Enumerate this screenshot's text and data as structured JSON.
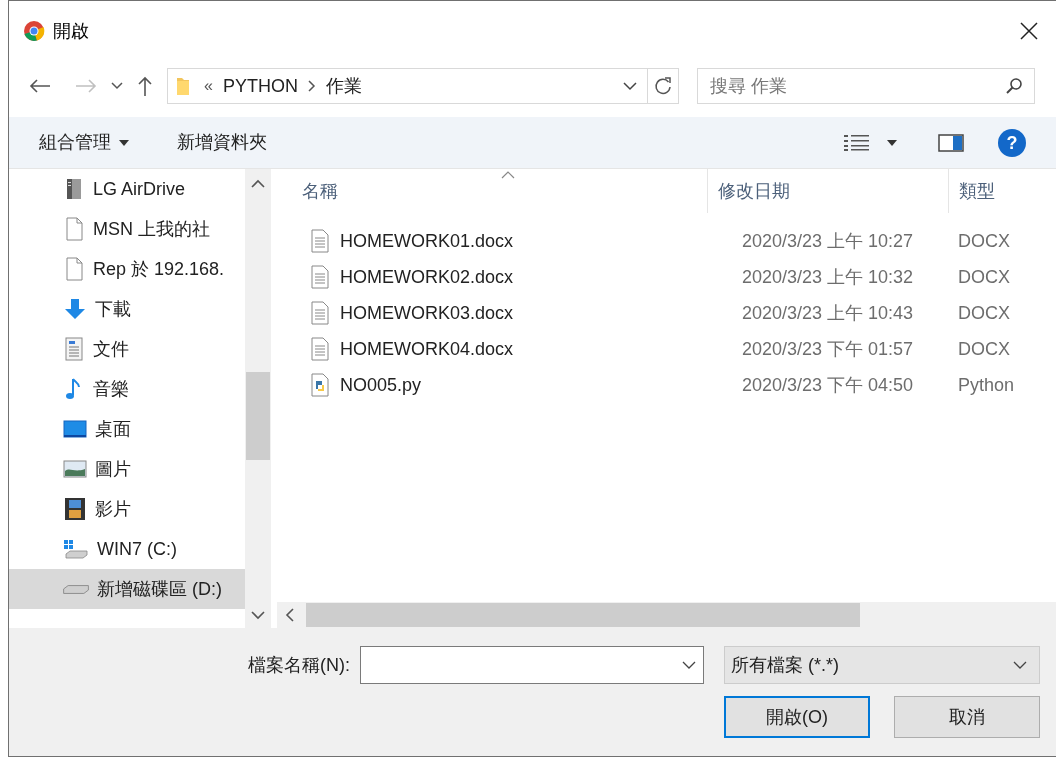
{
  "window": {
    "title": "開啟"
  },
  "address_bar": {
    "overflow": "«",
    "crumbs": [
      "PYTHON",
      "作業"
    ]
  },
  "search": {
    "placeholder": "搜尋 作業"
  },
  "command_bar": {
    "organize": "組合管理",
    "new_folder": "新增資料夾",
    "help": "?"
  },
  "sidebar": {
    "items": [
      {
        "label": "LG AirDrive",
        "kind": "server",
        "selected": false
      },
      {
        "label": "MSN 上我的社",
        "kind": "file",
        "selected": false
      },
      {
        "label": "Rep 於 192.168.",
        "kind": "file",
        "selected": false
      },
      {
        "label": "下載",
        "kind": "download",
        "selected": false
      },
      {
        "label": "文件",
        "kind": "document",
        "selected": false
      },
      {
        "label": "音樂",
        "kind": "music",
        "selected": false
      },
      {
        "label": "桌面",
        "kind": "desktop",
        "selected": false
      },
      {
        "label": "圖片",
        "kind": "pictures",
        "selected": false
      },
      {
        "label": "影片",
        "kind": "videos",
        "selected": false
      },
      {
        "label": "WIN7 (C:)",
        "kind": "system",
        "selected": false
      },
      {
        "label": "新增磁碟區 (D:)",
        "kind": "drive",
        "selected": true
      }
    ]
  },
  "table": {
    "columns": [
      {
        "label": "名稱",
        "sorted": true
      },
      {
        "label": "修改日期",
        "sorted": false
      },
      {
        "label": "類型",
        "sorted": false
      }
    ],
    "rows": [
      {
        "kind": "docx",
        "name": "HOMEWORK01.docx",
        "modified": "2020/3/23 上午 10:27",
        "type": "DOCX"
      },
      {
        "kind": "docx",
        "name": "HOMEWORK02.docx",
        "modified": "2020/3/23 上午 10:32",
        "type": "DOCX"
      },
      {
        "kind": "docx",
        "name": "HOMEWORK03.docx",
        "modified": "2020/3/23 上午 10:43",
        "type": "DOCX"
      },
      {
        "kind": "docx",
        "name": "HOMEWORK04.docx",
        "modified": "2020/3/23 下午 01:57",
        "type": "DOCX"
      },
      {
        "kind": "python",
        "name": "NO005.py",
        "modified": "2020/3/23 下午 04:50",
        "type": "Python"
      }
    ]
  },
  "footer": {
    "filename_label": "檔案名稱(N):",
    "filter": "所有檔案 (*.*)",
    "open_button": "開啟(O)",
    "cancel_button": "取消"
  }
}
